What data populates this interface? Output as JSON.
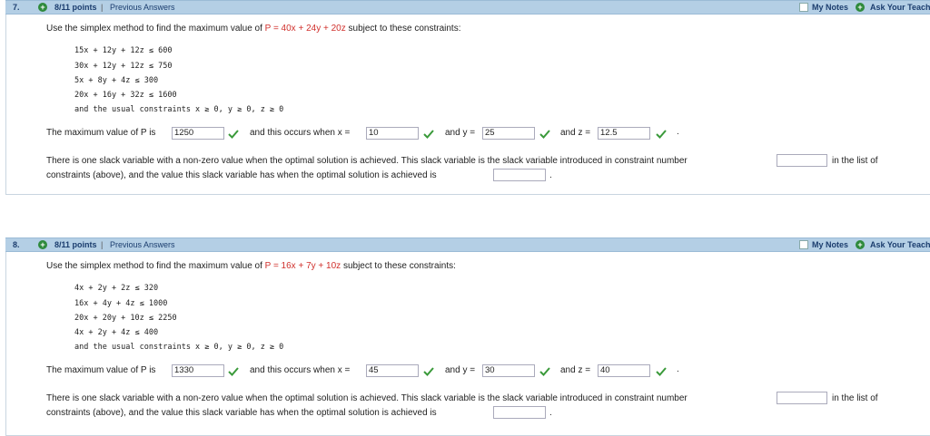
{
  "questions": [
    {
      "number": "7.",
      "points": "8/11 points",
      "previous_answers": "Previous Answers",
      "my_notes": "My Notes",
      "ask_teacher": "Ask Your Teacher",
      "statement_prefix": "Use the simplex method to find the maximum value of ",
      "objective": "P = 40x + 24y + 20z",
      "statement_suffix": " subject to these constraints:",
      "constraints": [
        "15x + 12y + 12z ≤ 600",
        "30x + 12y + 12z ≤ 750",
        "5x + 8y + 4z ≤ 300",
        "20x + 16y + 32z ≤ 1600",
        "and the usual constraints x ≥ 0, y ≥ 0, z ≥ 0"
      ],
      "max_label": "The maximum value of P is",
      "max_value": "1250",
      "x_label": "and this occurs when x =",
      "x_value": "10",
      "y_label": "and y =",
      "y_value": "25",
      "z_label": "and z =",
      "z_value": "12.5",
      "period": ".",
      "slack_text_1": "There is one slack variable with a non-zero value when the optimal solution is achieved. This slack variable is the slack variable introduced in constraint number",
      "slack_text_2": "in the list of",
      "slack_text_3": "constraints (above), and the value this slack variable has when the optimal solution is achieved is",
      "constraint_number": "",
      "slack_value": ""
    },
    {
      "number": "8.",
      "points": "8/11 points",
      "previous_answers": "Previous Answers",
      "my_notes": "My Notes",
      "ask_teacher": "Ask Your Teacher",
      "statement_prefix": "Use the simplex method to find the maximum value of ",
      "objective": "P = 16x + 7y + 10z",
      "statement_suffix": " subject to these constraints:",
      "constraints": [
        "4x + 2y + 2z ≤ 320",
        "16x + 4y + 4z ≤ 1000",
        "20x + 20y + 10z ≤ 2250",
        "4x + 2y + 4z ≤ 400",
        "and the usual constraints x ≥ 0, y ≥ 0, z ≥ 0"
      ],
      "max_label": "The maximum value of P is",
      "max_value": "1330",
      "x_label": "and this occurs when x =",
      "x_value": "45",
      "y_label": "and y =",
      "y_value": "30",
      "z_label": "and z =",
      "z_value": "40",
      "period": ".",
      "slack_text_1": "There is one slack variable with a non-zero value when the optimal solution is achieved. This slack variable is the slack variable introduced in constraint number",
      "slack_text_2": "in the list of",
      "slack_text_3": "constraints (above), and the value this slack variable has when the optimal solution is achieved is",
      "constraint_number": "",
      "slack_value": ""
    }
  ],
  "colors": {
    "header_bg": "#b4cfe5",
    "header_text": "#1b3d6e",
    "objective": "#d0312d",
    "check": "#3a9a3a"
  }
}
